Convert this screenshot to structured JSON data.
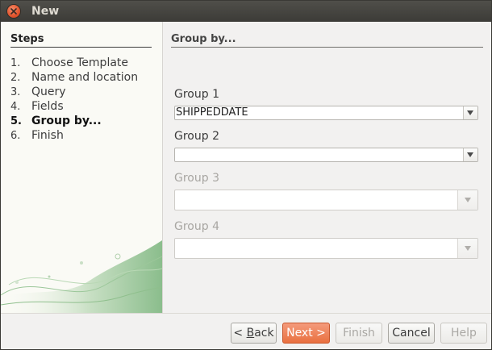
{
  "window": {
    "title": "New"
  },
  "steps": {
    "title": "Steps",
    "items": [
      {
        "num": "1.",
        "label": "Choose Template"
      },
      {
        "num": "2.",
        "label": "Name and location"
      },
      {
        "num": "3.",
        "label": "Query"
      },
      {
        "num": "4.",
        "label": "Fields"
      },
      {
        "num": "5.",
        "label": "Group by...",
        "active": true
      },
      {
        "num": "6.",
        "label": "Finish"
      }
    ]
  },
  "main": {
    "title": "Group by...",
    "groups": [
      {
        "label": "Group 1",
        "value": "SHIPPEDDATE",
        "enabled": true
      },
      {
        "label": "Group 2",
        "value": "",
        "enabled": true
      },
      {
        "label": "Group 3",
        "value": "",
        "enabled": false
      },
      {
        "label": "Group 4",
        "value": "",
        "enabled": false
      }
    ]
  },
  "buttons": {
    "back": {
      "pre": "< ",
      "mnemonic": "B",
      "post": "ack"
    },
    "next": "Next >",
    "finish": "Finish",
    "cancel": "Cancel",
    "help": "Help"
  },
  "colors": {
    "accent": "#e9703f",
    "titlebar": "#3c3b37"
  }
}
